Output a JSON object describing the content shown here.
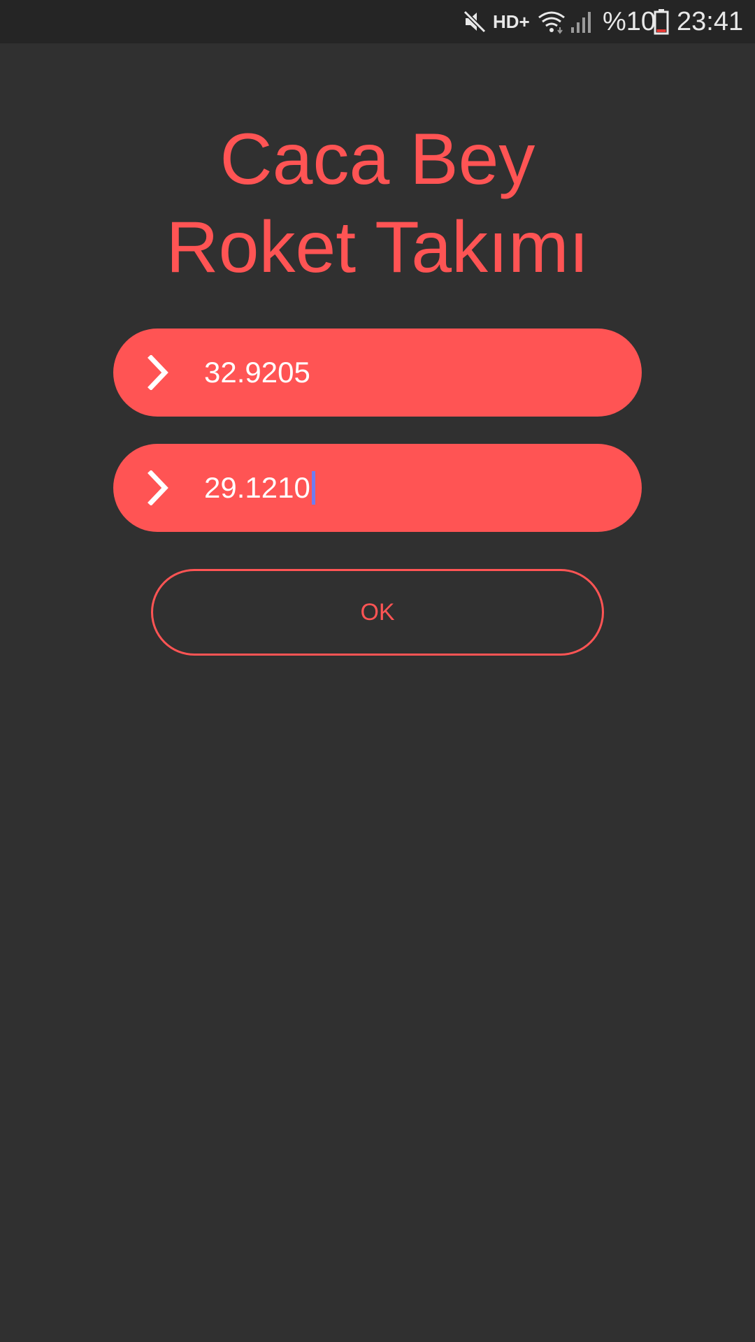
{
  "status_bar": {
    "hd_label": "HD+",
    "battery_text": "%10",
    "time": "23:41",
    "icons": [
      "mute-icon",
      "wifi-icon",
      "signal-icon",
      "battery-icon"
    ]
  },
  "title": {
    "line1": "Caca Bey",
    "line2": "Roket Takımı"
  },
  "fields": [
    {
      "value": "32.9205",
      "icon": "chevron-right-icon"
    },
    {
      "value": "29.1210",
      "icon": "chevron-right-icon",
      "focused": true
    }
  ],
  "ok_button": {
    "label": "OK"
  },
  "colors": {
    "accent": "#ff5454",
    "background": "#303030",
    "status_bar": "#252525",
    "cursor": "#6f7cf0"
  }
}
